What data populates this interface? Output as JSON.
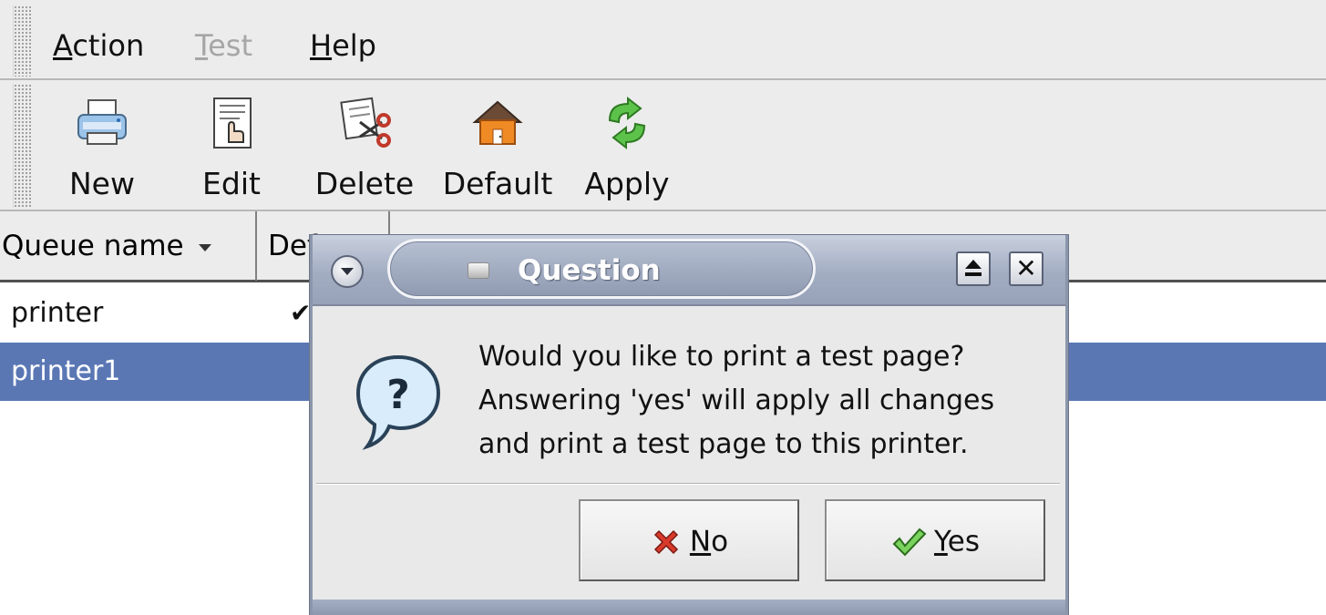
{
  "menubar": {
    "items": [
      {
        "label": "Action",
        "mnemonic": "A",
        "rest": "ction",
        "enabled": true
      },
      {
        "label": "Test",
        "mnemonic": "T",
        "rest": "est",
        "enabled": false
      },
      {
        "label": "Help",
        "mnemonic": "H",
        "rest": "elp",
        "enabled": true
      }
    ]
  },
  "toolbar": {
    "buttons": [
      {
        "label": "New",
        "icon": "printer-icon"
      },
      {
        "label": "Edit",
        "icon": "edit-document-icon"
      },
      {
        "label": "Delete",
        "icon": "scissors-icon"
      },
      {
        "label": "Default",
        "icon": "home-icon"
      },
      {
        "label": "Apply",
        "icon": "refresh-arrows-icon"
      }
    ]
  },
  "table": {
    "columns": [
      "Queue name",
      "Def"
    ],
    "rows": [
      {
        "queue": "printer",
        "default_mark": "✔",
        "selected": false
      },
      {
        "queue": "printer1",
        "default_mark": "",
        "selected": true
      }
    ]
  },
  "dialog": {
    "title": "Question",
    "message_lines": [
      "Would you like to print a test page?",
      "Answering 'yes' will apply all changes",
      "and print a test page to this printer."
    ],
    "buttons": {
      "no": {
        "label": "No",
        "mnemonic": "N",
        "rest": "o",
        "icon": "red-x-icon"
      },
      "yes": {
        "label": "Yes",
        "mnemonic": "Y",
        "rest": "es",
        "icon": "green-check-icon"
      }
    },
    "titlebar_buttons": [
      "maximize-icon",
      "close-icon"
    ],
    "close_glyph": "✕"
  },
  "colors": {
    "selection": "#5a77b4",
    "window_bg": "#ececec",
    "titlebar": "#a3adc2"
  }
}
